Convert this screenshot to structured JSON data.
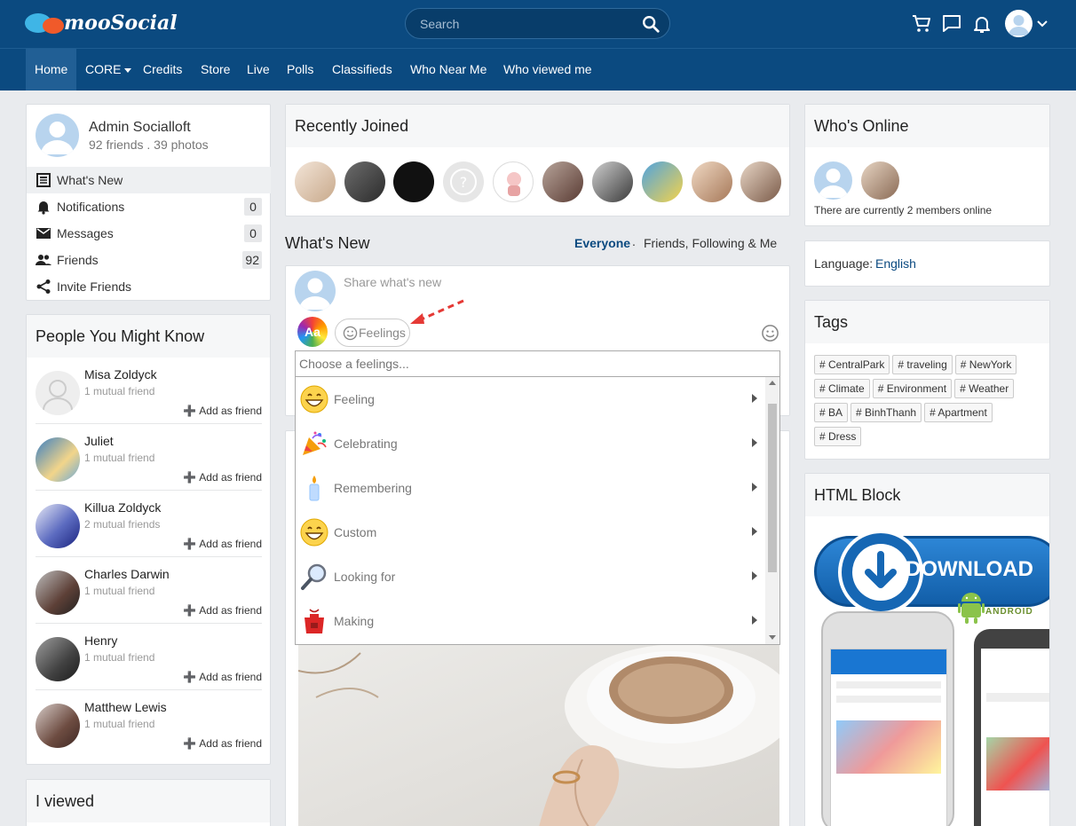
{
  "brand": {
    "name": "mooSocial",
    "bubble_blue": "#3fb5e6",
    "bubble_orange": "#f05a2a"
  },
  "colors": {
    "header_bg": "#0b4a80",
    "active_nav": "#215f95",
    "link": "#0b4a80",
    "annotation_arrow": "#e53935"
  },
  "search": {
    "placeholder": "Search"
  },
  "header_icons": [
    "cart-icon",
    "chat-icon",
    "bell-icon",
    "user-avatar-icon",
    "chevron-down-icon"
  ],
  "nav": {
    "items": [
      {
        "label": "Home"
      },
      {
        "label": "CORE"
      },
      {
        "label": "Credits"
      },
      {
        "label": "Store"
      },
      {
        "label": "Live"
      },
      {
        "label": "Polls"
      },
      {
        "label": "Classifieds"
      },
      {
        "label": "Who Near Me"
      },
      {
        "label": "Who viewed me"
      }
    ]
  },
  "profile": {
    "name": "Admin Socialloft",
    "stats": "92 friends . 39 photos",
    "menu": [
      {
        "label": "What's New",
        "icon": "newspaper-icon"
      },
      {
        "label": "Notifications",
        "icon": "bell-icon",
        "count": "0"
      },
      {
        "label": "Messages",
        "icon": "envelope-icon",
        "count": "0"
      },
      {
        "label": "Friends",
        "icon": "friends-icon",
        "count": "92"
      },
      {
        "label": "Invite Friends",
        "icon": "share-icon"
      }
    ]
  },
  "pymk": {
    "title": "People You Might Know",
    "add_label": "Add as friend",
    "people": [
      {
        "name": "Misa Zoldyck",
        "mutual": "1 mutual friend"
      },
      {
        "name": "Juliet",
        "mutual": "1 mutual friend"
      },
      {
        "name": "Killua Zoldyck",
        "mutual": "2 mutual friends"
      },
      {
        "name": "Charles Darwin",
        "mutual": "1 mutual friend"
      },
      {
        "name": "Henry",
        "mutual": "1 mutual friend"
      },
      {
        "name": "Matthew Lewis",
        "mutual": "1 mutual friend"
      }
    ]
  },
  "iviewed": {
    "title": "I viewed"
  },
  "recently_joined": {
    "title": "Recently Joined"
  },
  "whats_new": {
    "title": "What's New",
    "filter_everyone": "Everyone",
    "filter_sep": ".",
    "filter_friends": "Friends, Following & Me",
    "composer_placeholder": "Share what's new",
    "aa_label": "Aa",
    "feelings_label": "Feelings",
    "feelings_search_placeholder": "Choose a feelings...",
    "feelings": [
      {
        "label": "Feeling",
        "icon": "grin-emoji-icon"
      },
      {
        "label": "Celebrating",
        "icon": "party-popper-icon"
      },
      {
        "label": "Remembering",
        "icon": "candle-icon"
      },
      {
        "label": "Custom",
        "icon": "grin-emoji-icon"
      },
      {
        "label": "Looking for",
        "icon": "magnifier-icon"
      },
      {
        "label": "Making",
        "icon": "apron-icon"
      }
    ]
  },
  "whos_online": {
    "title": "Who's Online",
    "status": "There are currently 2 members online"
  },
  "language": {
    "label": "Language:",
    "value": "English"
  },
  "tags": {
    "title": "Tags",
    "items": [
      "# CentralPark",
      "# traveling",
      "# NewYork",
      "# Climate",
      "# Environment",
      "# Weather",
      "# BA",
      "# BinhThanh",
      "# Apartment",
      "# Dress"
    ]
  },
  "html_block": {
    "title": "HTML Block",
    "download_label": "DOWNLOAD",
    "android_label": "ANDROID"
  }
}
